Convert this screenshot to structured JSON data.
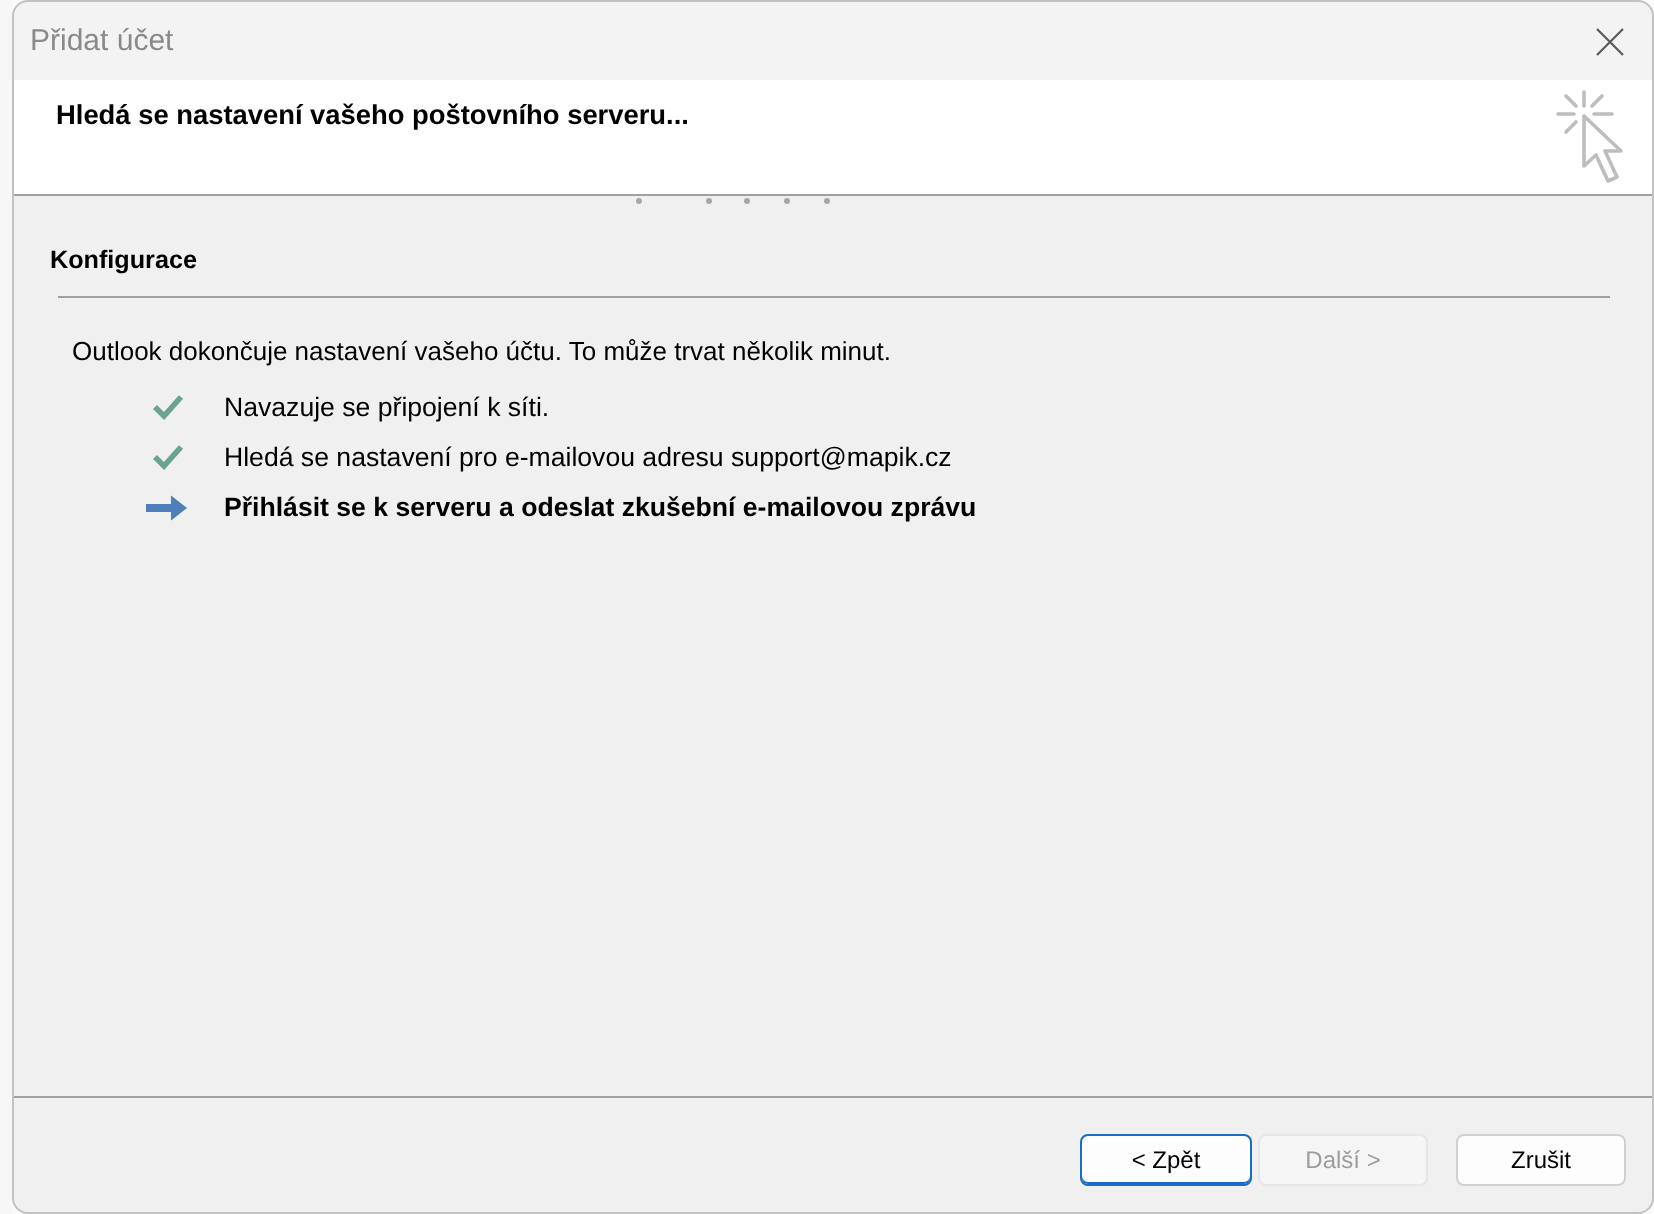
{
  "window": {
    "title": "Přidat účet"
  },
  "header": {
    "title": "Hledá se nastavení vašeho poštovního serveru..."
  },
  "section": {
    "title": "Konfigurace",
    "intro": "Outlook dokončuje nastavení vašeho účtu. To může trvat několik minut.",
    "steps": [
      {
        "label": "Navazuje se připojení k síti.",
        "kind": "done"
      },
      {
        "label": "Hledá se nastavení pro e-mailovou adresu support@mapik.cz",
        "kind": "done"
      },
      {
        "label": "Přihlásit se k serveru a odeslat zkušební e-mailovou zprávu",
        "kind": "current"
      }
    ]
  },
  "buttons": [
    {
      "label": "< Zpět",
      "disabled": false,
      "focused": true
    },
    {
      "label": "Další >",
      "disabled": true,
      "focused": false
    },
    {
      "label": "Zrušit",
      "disabled": false,
      "focused": false
    }
  ]
}
